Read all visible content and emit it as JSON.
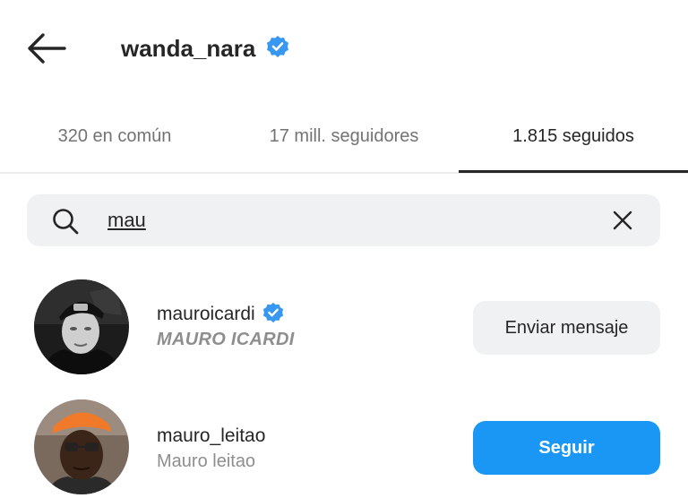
{
  "header": {
    "title": "wanda_nara",
    "verified": true
  },
  "tabs": [
    {
      "label": "320 en común"
    },
    {
      "label": "17 mill. seguidores"
    },
    {
      "label": "1.815 seguidos",
      "active": true
    }
  ],
  "search": {
    "value": "mau"
  },
  "users": [
    {
      "username": "mauroicardi",
      "verified": true,
      "full_name": "MAURO ICARDI",
      "action_label": "Enviar mensaje"
    },
    {
      "username": "mauro_leitao",
      "verified": false,
      "full_name": "Mauro leitao",
      "action_label": "Seguir"
    }
  ],
  "colors": {
    "accent": "#1a97f5",
    "verified_badge": "#3897f0",
    "secondary_text": "#8e8e8e"
  }
}
